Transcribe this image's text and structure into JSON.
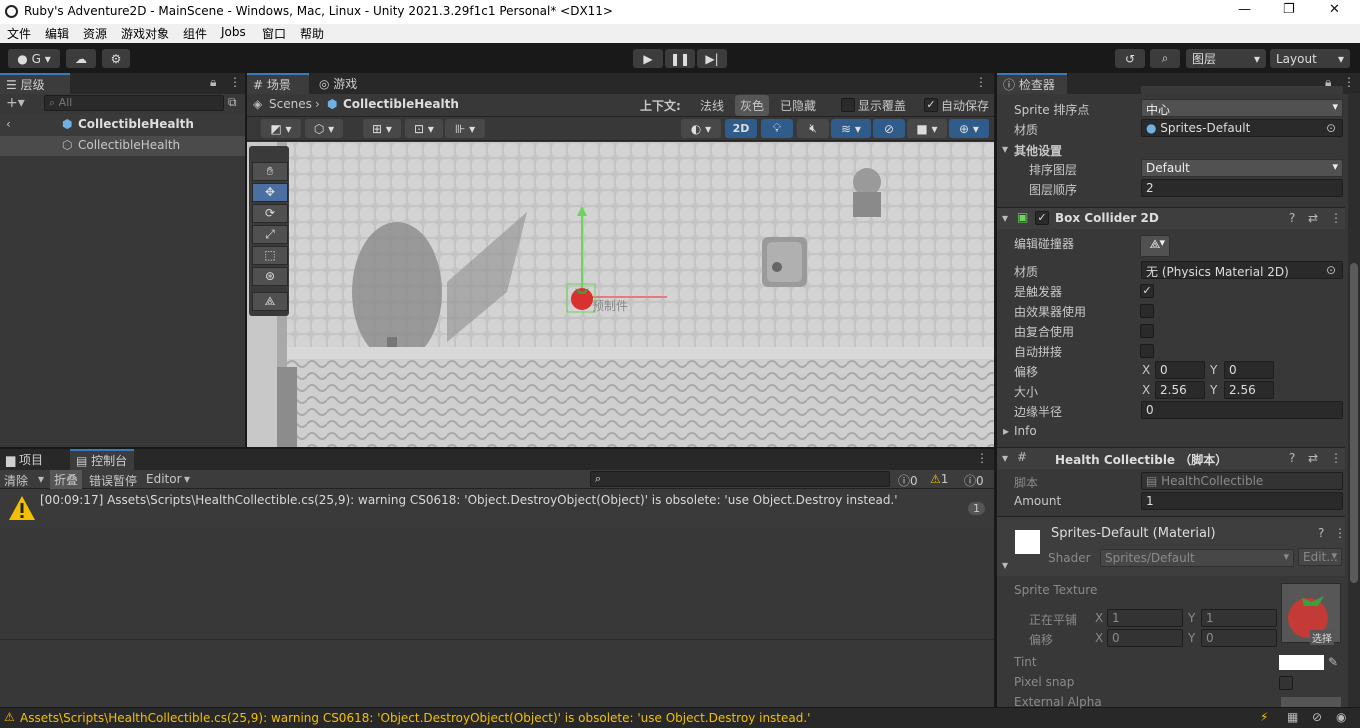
{
  "window": {
    "title": "Ruby's Adventure2D - MainScene - Windows, Mac, Linux - Unity 2021.3.29f1c1 Personal* <DX11>",
    "minimize": "—",
    "maximize": "❐",
    "close": "✕"
  },
  "menu": [
    "文件",
    "编辑",
    "资源",
    "游戏对象",
    "组件",
    "Jobs",
    "窗口",
    "帮助"
  ],
  "toolbar": {
    "account": "G",
    "layers": "图层",
    "layout": "Layout"
  },
  "hierarchy": {
    "tab": "层级",
    "search_placeholder": "All",
    "root": "CollectibleHealth",
    "child": "CollectibleHealth"
  },
  "scene": {
    "tab_scene": "场景",
    "tab_game": "游戏",
    "crumb_root": "Scenes",
    "crumb_item": "CollectibleHealth",
    "context_label": "上下文:",
    "mode_normal": "法线",
    "mode_gray": "灰色",
    "mode_hidden": "已隐藏",
    "overlay_label": "显示覆盖",
    "autosave_label": "自动保存",
    "toggle_2d": "2D",
    "gizmo_label": "预制件"
  },
  "console": {
    "tab_project": "项目",
    "tab_console": "控制台",
    "clear": "清除",
    "collapse": "折叠",
    "error_pause": "错误暂停",
    "editor": "Editor",
    "count_errors": "0",
    "count_warnings": "1",
    "count_logs": "0",
    "message": "[00:09:17] Assets\\Scripts\\HealthCollectible.cs(25,9): warning CS0618: 'Object.DestroyObject(Object)' is obsolete: 'use Object.Destroy instead.'",
    "message_count": "1"
  },
  "statusbar": {
    "message": "Assets\\Scripts\\HealthCollectible.cs(25,9): warning CS0618: 'Object.DestroyObject(Object)' is obsolete: 'use Object.Destroy instead.'"
  },
  "inspector": {
    "tab": "检查器",
    "sprite_pivot_label": "Sprite 排序点",
    "sprite_pivot_value": "中心",
    "material_label": "材质",
    "material_value": "Sprites-Default",
    "other_settings": "其他设置",
    "sorting_layer_label": "排序图层",
    "sorting_layer_value": "Default",
    "order_label": "图层顺序",
    "order_value": "2",
    "box_collider": {
      "title": "Box Collider 2D",
      "edit_label": "编辑碰撞器",
      "material_label": "材质",
      "material_value": "无 (Physics Material 2D)",
      "is_trigger": "是触发器",
      "used_by_effector": "由效果器使用",
      "used_by_composite": "由复合使用",
      "auto_tiling": "自动拼接",
      "offset_label": "偏移",
      "offset_x": "0",
      "offset_y": "0",
      "size_label": "大小",
      "size_x": "2.56",
      "size_y": "2.56",
      "edge_label": "边缘半径",
      "edge_value": "0",
      "info": "Info",
      "x": "X",
      "y": "Y"
    },
    "health": {
      "title": "Health Collectible （脚本）",
      "script_label": "脚本",
      "script_value": "HealthCollectible",
      "amount_label": "Amount",
      "amount_value": "1"
    },
    "material_asset": {
      "title": "Sprites-Default (Material)",
      "shader_label": "Shader",
      "shader_value": "Sprites/Default",
      "edit": "Edit...",
      "sprite_texture": "Sprite Texture",
      "tiling_label": "正在平铺",
      "tiling_x": "1",
      "tiling_y": "1",
      "offset_label": "偏移",
      "offset_x": "0",
      "offset_y": "0",
      "select": "选择",
      "tint": "Tint",
      "pixel_snap": "Pixel snap",
      "external_alpha": "External Alpha"
    }
  }
}
